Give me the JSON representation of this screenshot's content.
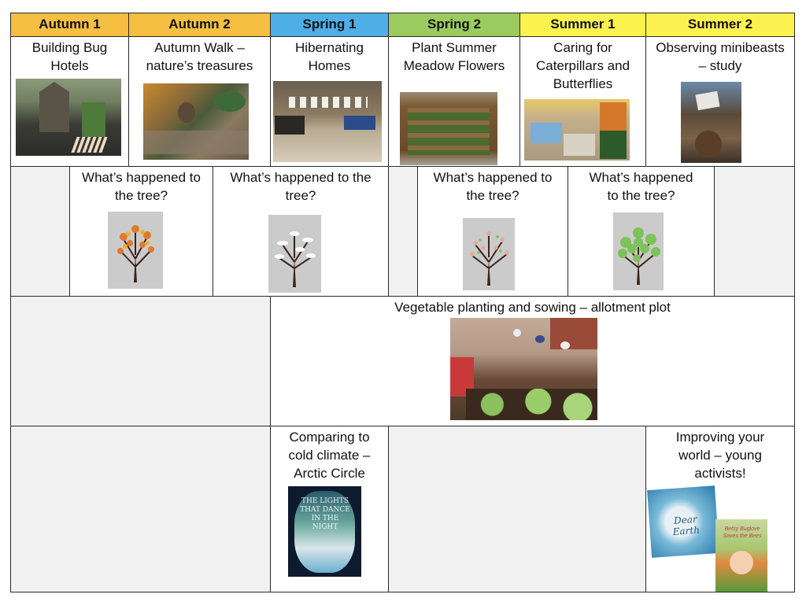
{
  "headers": [
    {
      "label": "Autumn 1",
      "color": "#f5bf42"
    },
    {
      "label": "Autumn 2",
      "color": "#f5bf42"
    },
    {
      "label": "Spring 1",
      "color": "#4eaee6"
    },
    {
      "label": "Spring 2",
      "color": "#9bcb5f"
    },
    {
      "label": "Summer 1",
      "color": "#fbf250"
    },
    {
      "label": "Summer 2",
      "color": "#fbf250"
    }
  ],
  "topics": [
    {
      "text": "Building Bug Hotels",
      "image": "bug-hotel-photo"
    },
    {
      "text": "Autumn Walk – nature’s treasures",
      "image": "autumn-leaves-photo"
    },
    {
      "text": "Hibernating Homes",
      "image": "hibernation-display-photo"
    },
    {
      "text": "Plant Summer Meadow Flowers",
      "image": "planter-photo"
    },
    {
      "text": "Caring for Caterpillars and Butterflies",
      "image": "butterfly-display-photo"
    },
    {
      "text": "Observing minibeasts – study",
      "image": "children-observing-photo"
    }
  ],
  "trees": [
    {
      "text": "What’s happened to the tree?",
      "season": "autumn",
      "leaf_color": "#e07a2a"
    },
    {
      "text": "What’s happened to the tree?",
      "season": "winter",
      "leaf_color": "#f5f5f5"
    },
    {
      "text": "What’s happened to the tree?",
      "season": "spring",
      "leaf_color": "#e9a8a0"
    },
    {
      "text": "What’s happened to the tree?",
      "season": "summer",
      "leaf_color": "#7cc35a"
    }
  ],
  "vegetable": {
    "text": "Vegetable planting and sowing – allotment plot",
    "image": "allotment-photo"
  },
  "arctic": {
    "text": "Comparing to cold climate – Arctic Circle",
    "book_title": "THE LIGHTS THAT DANCE IN THE NIGHT"
  },
  "activists": {
    "text": "Improving your world – young activists!",
    "book1_title": "Dear Earth",
    "book2_title": "Betsy Buglove Saves the Bees"
  }
}
